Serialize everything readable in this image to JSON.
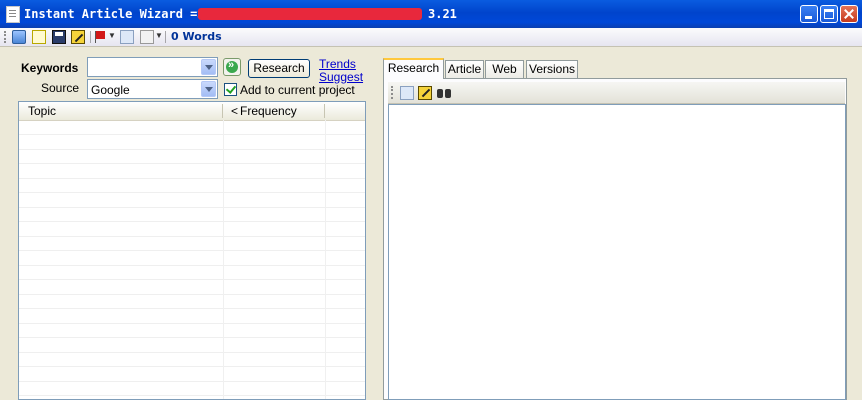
{
  "window": {
    "title_prefix": "Instant Article Wizard =>",
    "title_version": "3.21"
  },
  "toolbar": {
    "word_count": "0 Words",
    "icons": [
      "folder-open-icon",
      "new-document-icon",
      "save-icon",
      "edit-icon",
      "flag-icon",
      "pages-icon",
      "document-icon"
    ]
  },
  "search": {
    "keywords_label": "Keywords",
    "keywords_value": "",
    "source_label": "Source",
    "source_value": "Google",
    "research_button": "Research",
    "trends_link": "Trends",
    "suggest_link": "Suggest",
    "add_to_project_label": "Add to current project",
    "add_to_project_checked": true
  },
  "table": {
    "columns": [
      "Topic",
      "Frequency"
    ],
    "sort_indicator": "<",
    "rows": []
  },
  "tabs": {
    "items": [
      "Research",
      "Article",
      "Web",
      "Versions"
    ],
    "active": "Research"
  },
  "colors": {
    "titlebar": "#0a5ce0",
    "window_bg": "#ece9d8",
    "link": "#0000cc",
    "active_tab_accent": "#ffc83c"
  }
}
